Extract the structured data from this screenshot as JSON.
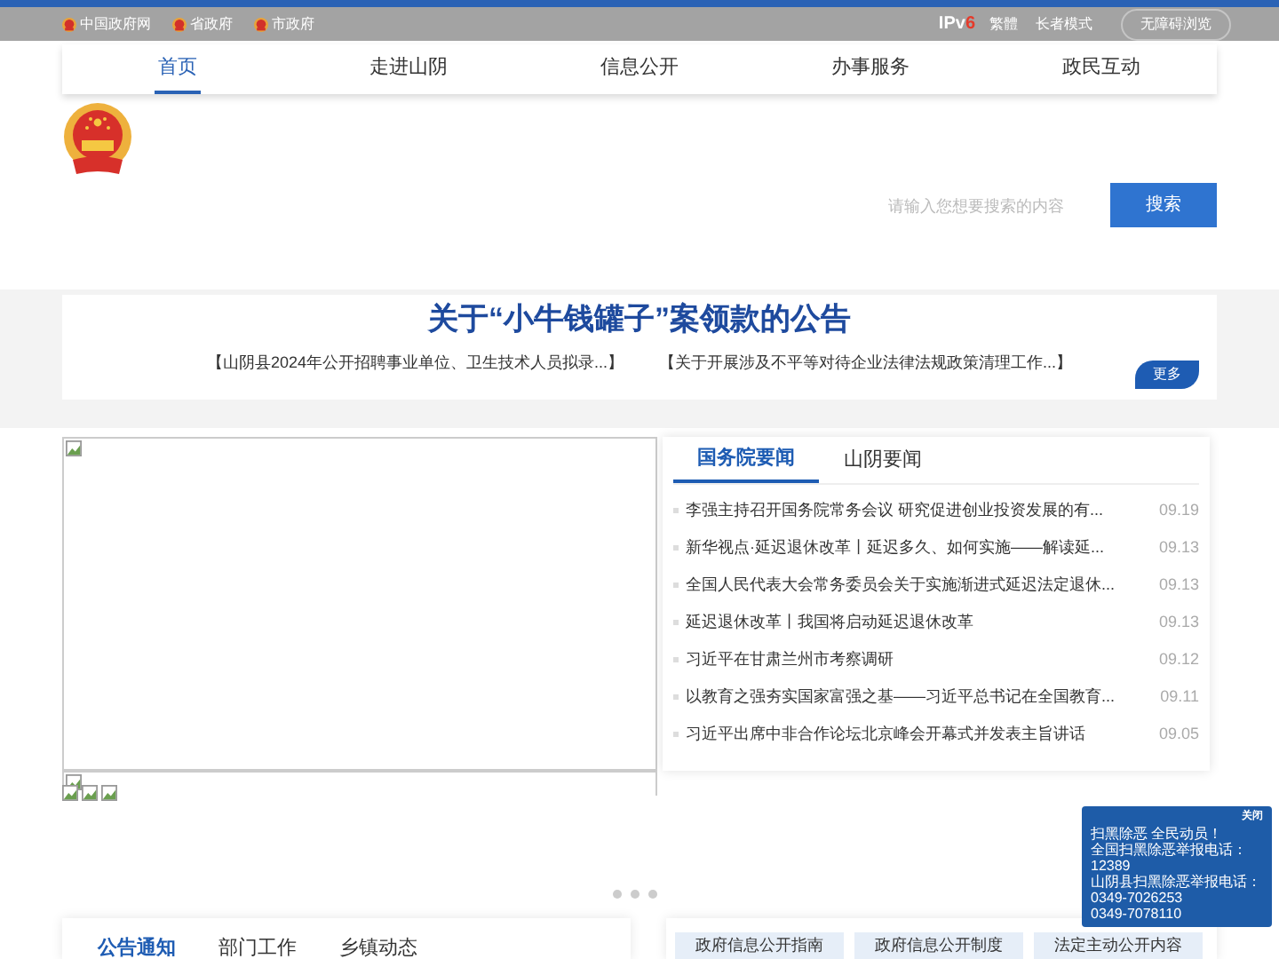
{
  "top_bar": {
    "links": [
      "中国政府网",
      "省政府",
      "市政府"
    ],
    "ipv6": {
      "ip": "IPv",
      "six": "6"
    },
    "tools": [
      "繁體",
      "长者模式"
    ],
    "accessibility": "无障碍浏览"
  },
  "nav": [
    {
      "label": "首页",
      "selected": true
    },
    {
      "label": "走进山阴",
      "selected": false
    },
    {
      "label": "信息公开",
      "selected": false
    },
    {
      "label": "办事服务",
      "selected": false
    },
    {
      "label": "政民互动",
      "selected": false
    }
  ],
  "search": {
    "placeholder": "请输入您想要搜索的内容",
    "button": "搜索"
  },
  "headline": {
    "title": "关于“小牛钱罐子”案领款的公告",
    "links": [
      "【山阴县2024年公开招聘事业单位、卫生技术人员拟录...】",
      "【关于开展涉及不平等对待企业法律法规政策清理工作...】"
    ],
    "more": "更多"
  },
  "news": {
    "tabs": [
      {
        "label": "国务院要闻",
        "selected": true
      },
      {
        "label": "山阴要闻",
        "selected": false
      }
    ],
    "items": [
      {
        "title": "李强主持召开国务院常务会议 研究促进创业投资发展的有...",
        "date": "09.19"
      },
      {
        "title": "新华视点·延迟退休改革丨延迟多久、如何实施——解读延...",
        "date": "09.13"
      },
      {
        "title": "全国人民代表大会常务委员会关于实施渐进式延迟法定退休...",
        "date": "09.13"
      },
      {
        "title": "延迟退休改革丨我国将启动延迟退休改革",
        "date": "09.13"
      },
      {
        "title": "习近平在甘肃兰州市考察调研",
        "date": "09.12"
      },
      {
        "title": "以教育之强夯实国家富强之基——习近平总书记在全国教育...",
        "date": "09.11"
      },
      {
        "title": "习近平出席中非合作论坛北京峰会开幕式并发表主旨讲话",
        "date": "09.05"
      }
    ]
  },
  "bottom_tabs": [
    {
      "label": "公告通知",
      "selected": true
    },
    {
      "label": "部门工作",
      "selected": false
    },
    {
      "label": "乡镇动态",
      "selected": false
    }
  ],
  "open_links": [
    "政府信息公开指南",
    "政府信息公开制度",
    "法定主动公开内容"
  ],
  "popup": {
    "close": "关闭",
    "lines": [
      "扫黑除恶 全民动员！",
      "全国扫黑除恶举报电话：",
      "12389",
      "山阴县扫黑除恶举报电话：",
      "0349-7026253",
      "0349-7078110"
    ]
  }
}
